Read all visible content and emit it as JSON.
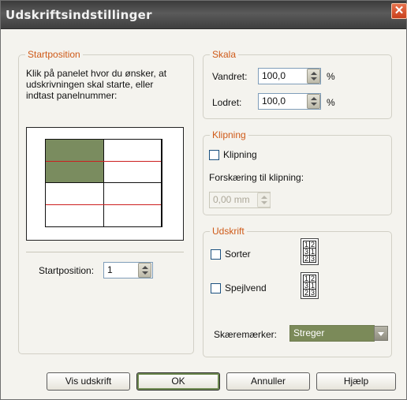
{
  "window": {
    "title": "Udskriftsindstillinger",
    "close_symbol": "✕"
  },
  "startposition": {
    "legend": "Startposition",
    "instructions": [
      "Klik på panelet hvor du ønsker, at",
      "udskrivningen skal starte, eller",
      "indtast panelnummer:"
    ],
    "panels": [
      {
        "row": 1,
        "col": 1,
        "selected": true
      },
      {
        "row": 1,
        "col": 2,
        "selected": false
      },
      {
        "row": 2,
        "col": 1,
        "selected": false
      },
      {
        "row": 2,
        "col": 2,
        "selected": false
      }
    ],
    "field_label": "Startposition:",
    "field_value": "1"
  },
  "skala": {
    "legend": "Skala",
    "horizontal_label": "Vandret:",
    "horizontal_value": "100,0",
    "vertical_label": "Lodret:",
    "vertical_value": "100,0",
    "unit": "%"
  },
  "klipning": {
    "legend": "Klipning",
    "checkbox_label": "Klipning",
    "checked": false,
    "offset_label": "Forskæring til klipning:",
    "offset_value": "0,00 mm",
    "offset_enabled": false
  },
  "udskrift": {
    "legend": "Udskrift",
    "sort_label": "Sorter",
    "sort_checked": false,
    "sort_order": [
      [
        "1",
        "2"
      ],
      [
        "3",
        "1"
      ],
      [
        "2",
        "3"
      ]
    ],
    "mirror_label": "Spejlvend",
    "mirror_checked": false,
    "mirror_order": [
      [
        "1",
        "2"
      ],
      [
        "3",
        "1"
      ],
      [
        "2",
        "3"
      ]
    ],
    "cutmarks_label": "Skæremærker:",
    "cutmarks_value": "Streger"
  },
  "buttons": {
    "preview": "Vis udskrift",
    "ok": "OK",
    "cancel": "Annuller",
    "help": "Hjælp"
  },
  "colors": {
    "legend_text": "#cf5a18",
    "selected_panel": "#7a8c5f",
    "cut_line": "#cc1f1f"
  }
}
